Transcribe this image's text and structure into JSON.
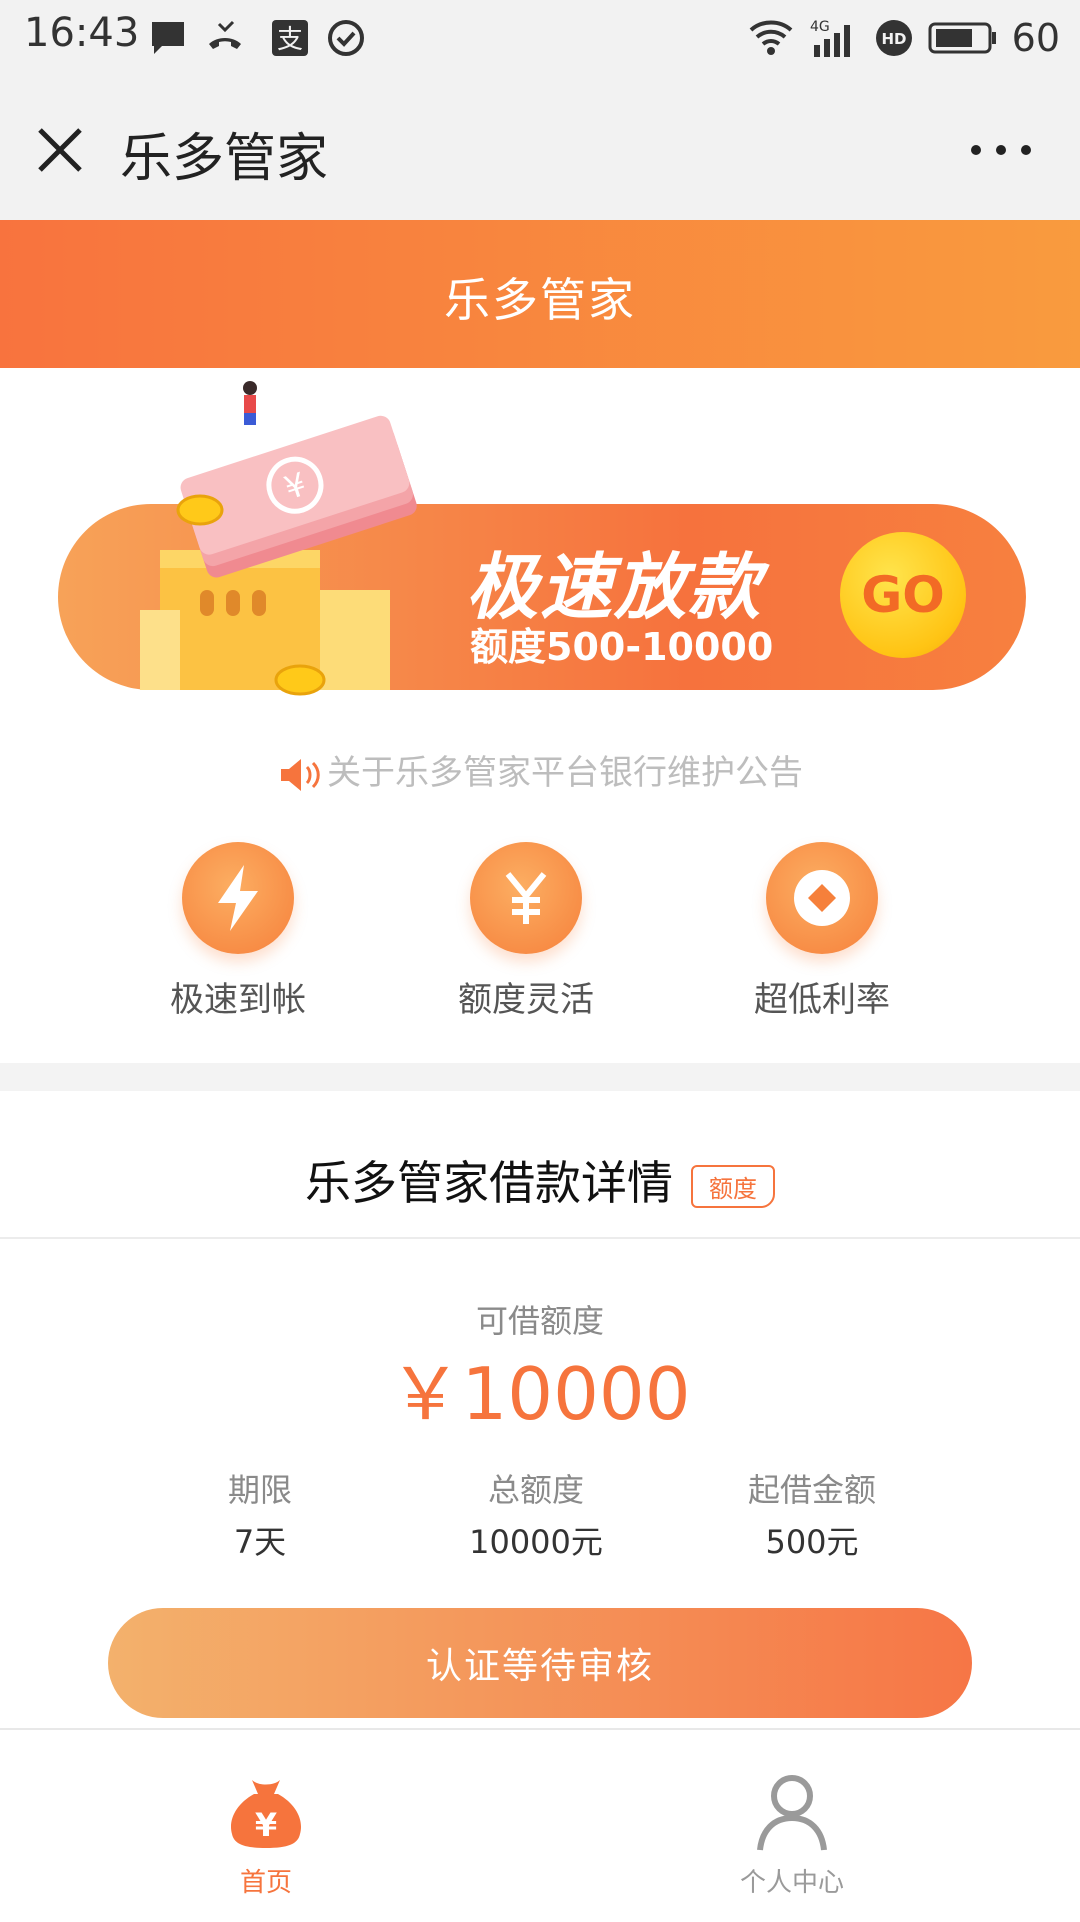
{
  "status_bar": {
    "time": "16:43",
    "battery": "60",
    "icons": [
      "message-icon",
      "missed-call-icon",
      "alipay-icon",
      "check-circle-icon",
      "wifi-icon",
      "signal-4g-icon",
      "hd-icon",
      "battery-icon"
    ]
  },
  "nav": {
    "title": "乐多管家"
  },
  "header": {
    "title": "乐多管家"
  },
  "banner": {
    "title": "极速放款",
    "subtitle": "额度500-10000",
    "go_label": "GO"
  },
  "notice": {
    "text": "关于乐多管家平台银行维护公告"
  },
  "features": [
    {
      "label": "极速到帐",
      "icon": "lightning-icon"
    },
    {
      "label": "额度灵活",
      "icon": "yuan-icon"
    },
    {
      "label": "超低利率",
      "icon": "coin-icon"
    }
  ],
  "detail": {
    "title": "乐多管家借款详情",
    "badge": "额度",
    "available_label": "可借额度",
    "available_amount": "￥10000",
    "stats": [
      {
        "label": "期限",
        "value": "7天"
      },
      {
        "label": "总额度",
        "value": "10000元"
      },
      {
        "label": "起借金额",
        "value": "500元"
      }
    ],
    "cta_label": "认证等待审核"
  },
  "tabs": [
    {
      "label": "首页",
      "icon": "money-bag-icon",
      "active": true
    },
    {
      "label": "个人中心",
      "icon": "person-icon",
      "active": false
    }
  ],
  "colors": {
    "accent": "#f6743d",
    "header_start": "#f8733e",
    "header_end": "#f99b3e",
    "muted_text": "#8a8a8a",
    "tab_inactive": "#9a9a9a"
  }
}
